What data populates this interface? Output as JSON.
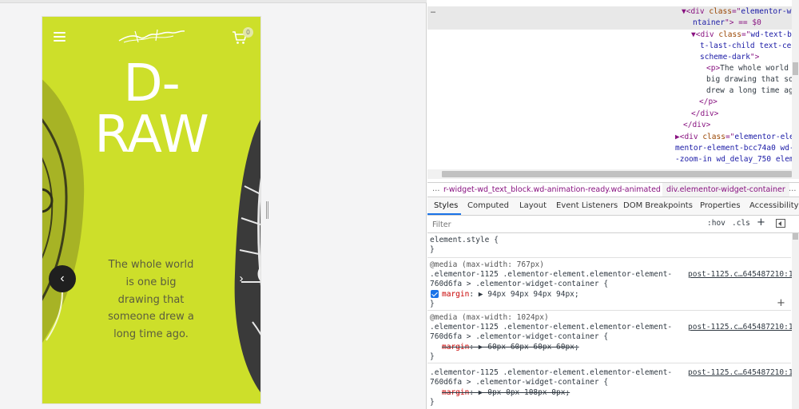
{
  "preview": {
    "hero_title_line1": "D-",
    "hero_title_line2": "RAW",
    "hero_text": "The whole world is one big drawing that someone drew a long time ago.",
    "cart_count": "0",
    "prev_icon": "‹",
    "next_icon": "›",
    "colors": {
      "background": "#cddf2a",
      "title": "#ffffff",
      "text": "#5b5d3e",
      "nav_button": "#1f1f1f"
    }
  },
  "dom": {
    "ellipsis": "…",
    "line1": {
      "tag_open": "▼<div ",
      "attr": "class",
      "eq": "=\"",
      "val": "elementor-w"
    },
    "line2": {
      "val": "ntainer",
      "rest": "\"> == $0"
    },
    "line3": {
      "tag_open": "▼<div ",
      "attr": "class",
      "val": "wd-text-b"
    },
    "line4": {
      "val": "t-last-child text-cente"
    },
    "line5": {
      "val": "scheme-dark",
      "rest": "\">"
    },
    "line6": {
      "tag": "<p>",
      "txt": "The whole world"
    },
    "line7": {
      "txt": "big drawing that so"
    },
    "line8": {
      "txt": "drew a long time ag"
    },
    "line9": {
      "tag": "</p>"
    },
    "line10": {
      "tag": "</div>"
    },
    "line11": {
      "tag": "</div>"
    },
    "line12": {
      "tag_open": "▶<div ",
      "attr": "class",
      "val": "elementor-ele"
    },
    "line13": {
      "val": "mentor-element-bcc74a0 wd-a"
    },
    "line14": {
      "val": "-zoom-in wd_delay_750 eleme"
    }
  },
  "breadcrumb": {
    "dots": "…",
    "crumb1": "r-widget-wd_text_block.wd-animation-ready.wd-animated",
    "crumb2": "div.elementor-widget-container",
    "more": "…"
  },
  "tabs": [
    "Styles",
    "Computed",
    "Layout",
    "Event Listeners",
    "DOM Breakpoints",
    "Properties",
    "Accessibility"
  ],
  "filter": {
    "placeholder": "Filter",
    "hov": ":hov",
    "cls": ".cls",
    "plus": "+"
  },
  "rules": {
    "r0": {
      "selector": "element.style {",
      "close": "}"
    },
    "r1": {
      "media": "@media (max-width: 767px)",
      "sel1": ".elementor-1125 .elementor-element.elementor-element-",
      "sel2": "760d6fa > .elementor-widget-container {",
      "prop": "margin",
      "value": "▶ 94px 94px 94px 94px;",
      "close": "}",
      "source": "post-1125.c…645487210:1"
    },
    "r2": {
      "media": "@media (max-width: 1024px)",
      "sel1": ".elementor-1125 .elementor-element.elementor-element-",
      "sel2": "760d6fa > .elementor-widget-container {",
      "prop": "margin",
      "value": "▶ 60px 60px 60px 60px;",
      "close": "}",
      "source": "post-1125.c…645487210:1"
    },
    "r3": {
      "sel1": ".elementor-1125 .elementor-element.elementor-element-",
      "sel2": "760d6fa > .elementor-widget-container {",
      "prop": "margin",
      "value": "▶ 0px 0px 108px 0px;",
      "close": "}",
      "source": "post-1125.c…645487210:1"
    },
    "add": "+"
  }
}
